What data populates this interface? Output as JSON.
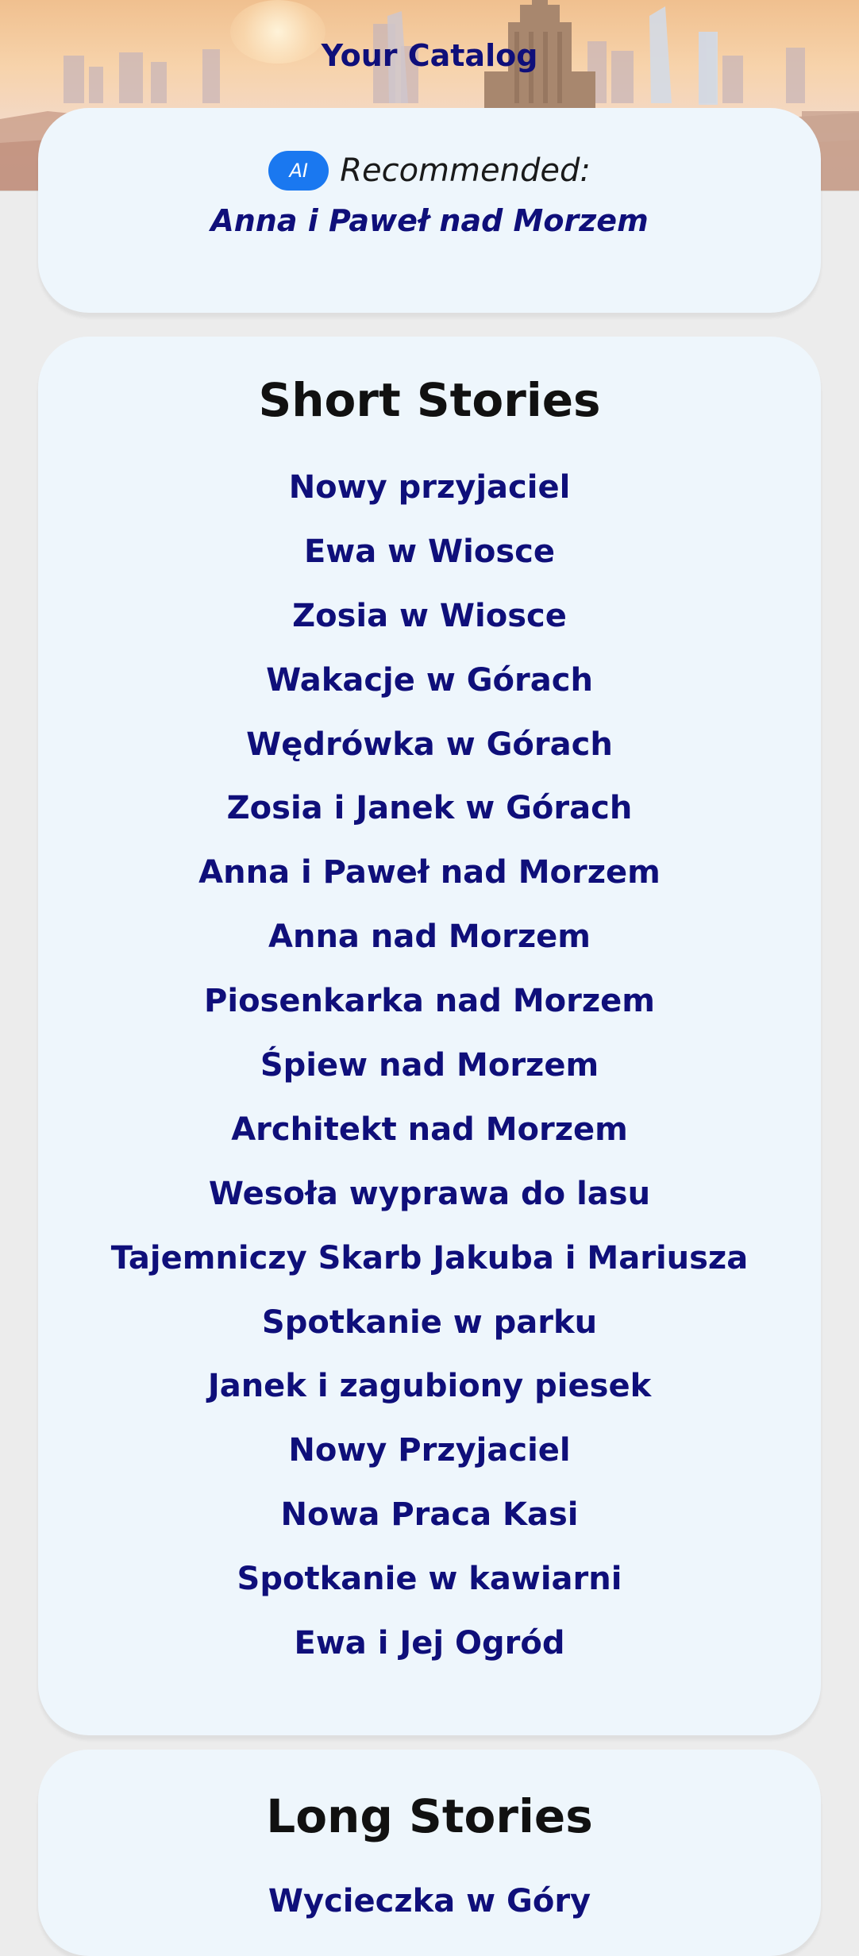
{
  "header": {
    "title": "Your Catalog"
  },
  "recommended": {
    "badge": "AI",
    "label": "Recommended:",
    "title": "Anna i Paweł nad Morzem"
  },
  "short_stories": {
    "heading": "Short Stories",
    "items": [
      "Nowy przyjaciel",
      "Ewa w Wiosce",
      "Zosia w Wiosce",
      "Wakacje w Górach",
      "Wędrówka w Górach",
      "Zosia i Janek w Górach",
      "Anna i Paweł nad Morzem",
      "Anna nad Morzem",
      "Piosenkarka nad Morzem",
      "Śpiew nad Morzem",
      "Architekt nad Morzem",
      "Wesoła wyprawa do lasu",
      "Tajemniczy Skarb Jakuba i Mariusza",
      "Spotkanie w parku",
      "Janek i zagubiony piesek",
      "Nowy Przyjaciel",
      "Nowa Praca Kasi",
      "Spotkanie w kawiarni",
      "Ewa i Jej Ogród"
    ]
  },
  "long_stories": {
    "heading": "Long Stories",
    "items": [
      "Wycieczka w Góry"
    ]
  },
  "colors": {
    "link": "#0f0f7a",
    "card_bg": "#eef6fc",
    "ai_badge": "#1a78f0",
    "page_bg": "#ececec"
  },
  "icons": {
    "hero": "city-skyline-image"
  }
}
